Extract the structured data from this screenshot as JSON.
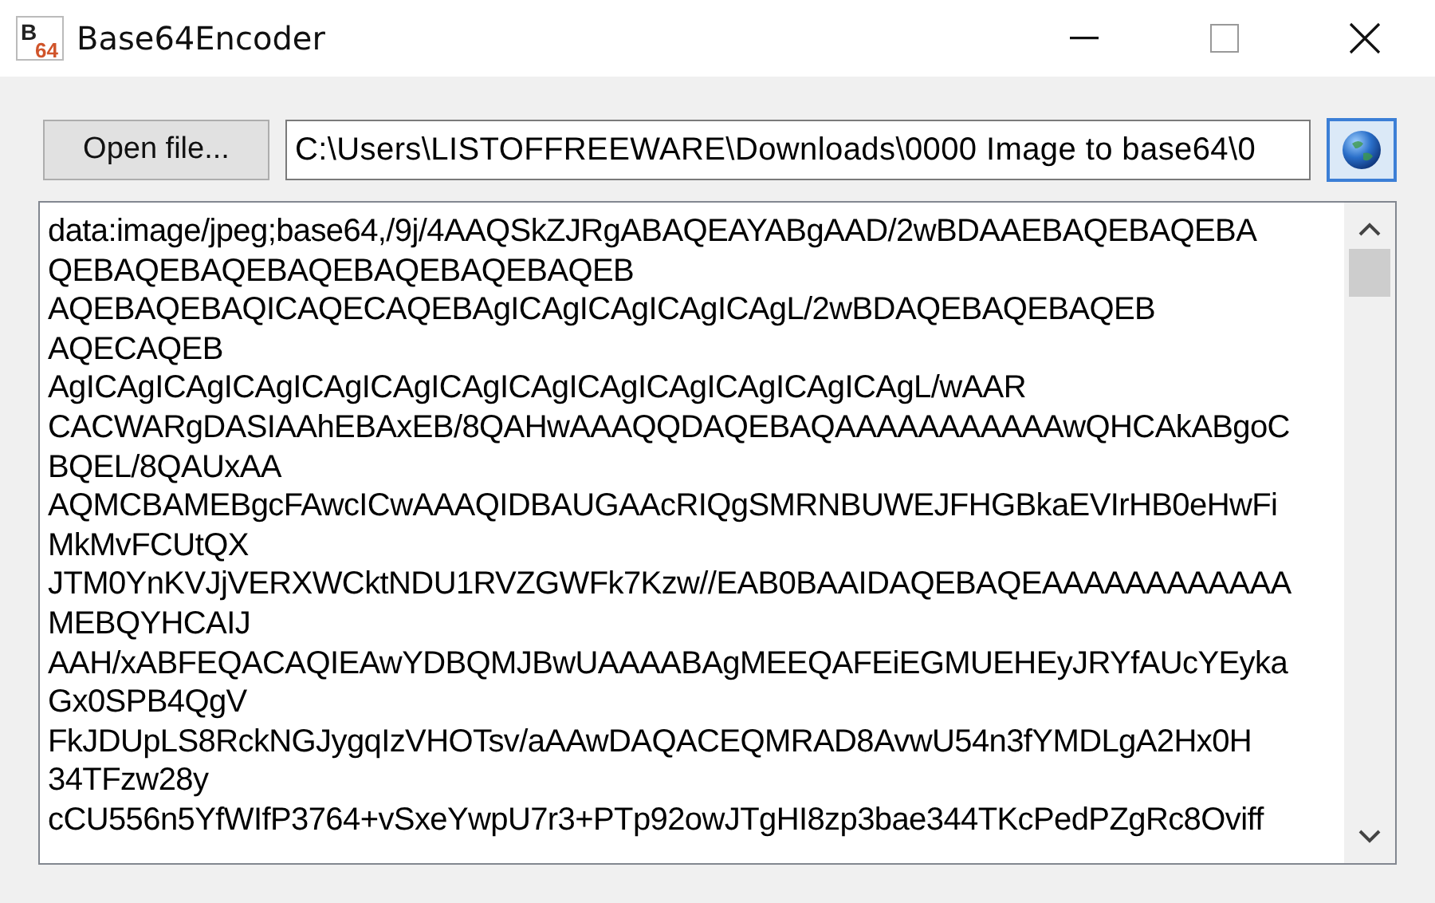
{
  "window": {
    "title": "Base64Encoder",
    "icon_text": [
      "B",
      "64"
    ]
  },
  "toolbar": {
    "open_button": "Open file...",
    "path_field": "C:\\Users\\LISTOFFREEWARE\\Downloads\\0000 Image to base64\\0"
  },
  "output": {
    "lines": [
      "data:image/jpeg;base64,/9j/4AAQSkZJRgABAQEAYABgAAD/2wBDAAEBAQEBAQEBA",
      "QEBAQEBAQEBAQEBAQEBAQEBAQEB",
      "AQEBAQEBAQICAQECAQEBAgICAgICAgICAgICAgL/2wBDAQEBAQEBAQEB",
      "AQECAQEB",
      "AgICAgICAgICAgICAgICAgICAgICAgICAgICAgICAgICAgICAgL/wAAR",
      "CACWARgDASIAAhEBAxEB/8QAHwAAAQQDAQEBAQAAAAAAAAAAAwQHCAkABgoC",
      "BQEL/8QAUxAA",
      "AQMCBAMEBgcFAwcICwAAAQIDBAUGAAcRIQgSMRNBUWEJFHGBkaEVIrHB0eHwFi",
      "MkMvFCUtQX",
      "JTM0YnKVJjVERXWCktNDU1RVZGWFk7Kzw//EAB0BAAIDAQEBAQEAAAAAAAAAAAA",
      "MEBQYHCAIJ",
      "AAH/xABFEQACAQIEAwYDBQMJBwUAAAABAgMEEQAFEiEGMUEHEyJRYfAUcYEyka",
      "Gx0SPB4QgV",
      "FkJDUpLS8RckNGJygqIzVHOTsv/aAAwDAQACEQMRAD8AvwU54n3fYMDLgA2Hx0H",
      "34TFzw28y",
      "cCU556n5YfWIfP3764+vSxeYwpU7r3+PTp92owJTgHI8zp3bae344TKcPedPZgRc8Oviff"
    ]
  }
}
